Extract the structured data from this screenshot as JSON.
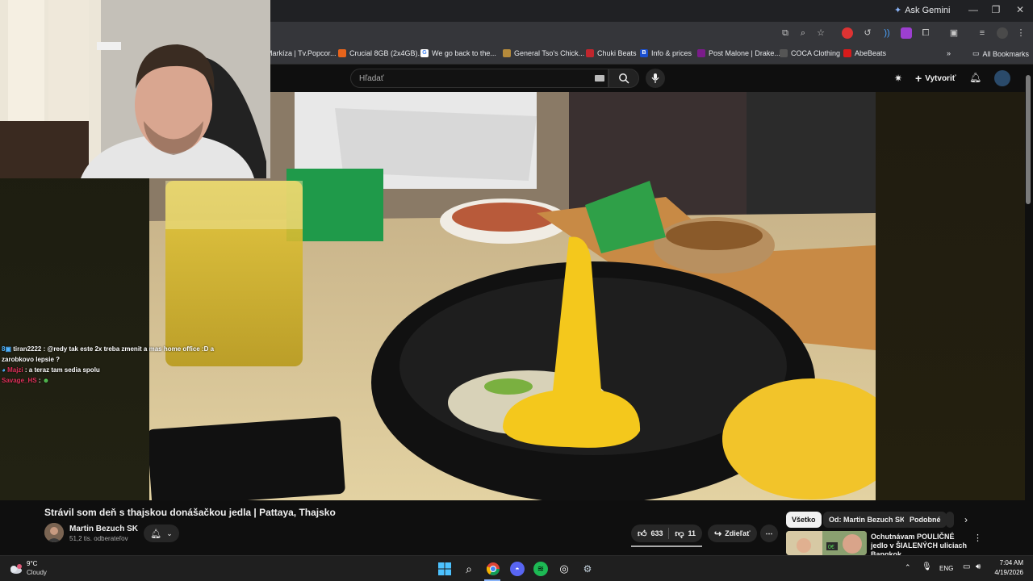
{
  "browser": {
    "ask_gemini": "Ask Gemini",
    "bookmarks": [
      {
        "label": "Markíza | Tv.Popcor...",
        "color": "#d33"
      },
      {
        "label": "Crucial 8GB (2x4GB)...",
        "color": "#e8641b"
      },
      {
        "label": "We go back to the...",
        "color": "#4285f4"
      },
      {
        "label": "General Tso's Chick...",
        "color": "#b58a3b"
      },
      {
        "label": "Chuki Beats",
        "color": "#c0262d"
      },
      {
        "label": "Info & prices",
        "color": "#1a4fd0"
      },
      {
        "label": "Post Malone | Drake...",
        "color": "#7a1c8a"
      },
      {
        "label": "COCA Clothing",
        "color": "#333"
      },
      {
        "label": "AbeBeats",
        "color": "#d81b1b"
      }
    ],
    "all_bookmarks": "All Bookmarks"
  },
  "youtube": {
    "search_placeholder": "Hľadať",
    "create_label": "Vytvoriť"
  },
  "chat": [
    {
      "user": "tiran2222",
      "user_color": "#f5f5f5",
      "message": "@redy tak este 2x treba zmenit a mas home office :D a zarobkovo lepsie ?"
    },
    {
      "user": "Majzi",
      "user_color": "#e0305a",
      "message": "a teraz tam sedia spolu"
    },
    {
      "user": "Savage_HS",
      "user_color": "#e0305a",
      "message": ""
    }
  ],
  "video": {
    "title": "Strávil som deň s thajskou donášačkou jedla | Pattaya, Thajsko",
    "channel": "Martin Bezuch SK",
    "subscribers": "51,2 tis. odberateľov",
    "likes": "633",
    "dislikes": "11",
    "share_label": "Zdieľať"
  },
  "sidebar": {
    "chips": [
      "Všetko",
      "Od: Martin Bezuch SK",
      "Podobné"
    ],
    "recommendation_title": "Ochutnávam POULIČNÉ jedlo v ŠIALENÝCH uliciach Bangkok..."
  },
  "taskbar": {
    "temperature": "9°C",
    "weather": "Cloudy",
    "language": "ENG",
    "time": "7:04 AM",
    "date": "4/19/2026"
  }
}
